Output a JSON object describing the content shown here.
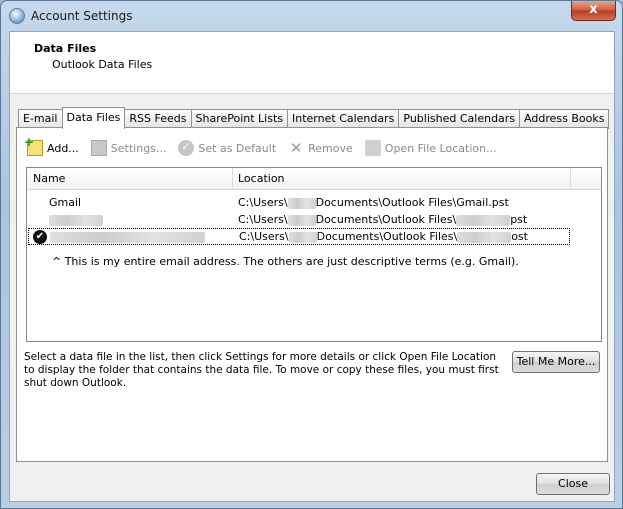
{
  "window": {
    "title": "Account Settings",
    "close_glyph": "x"
  },
  "header": {
    "title": "Data Files",
    "subtitle": "Outlook Data Files"
  },
  "tabs": [
    {
      "label": "E-mail"
    },
    {
      "label": "Data Files",
      "active": true
    },
    {
      "label": "RSS Feeds"
    },
    {
      "label": "SharePoint Lists"
    },
    {
      "label": "Internet Calendars"
    },
    {
      "label": "Published Calendars"
    },
    {
      "label": "Address Books"
    }
  ],
  "toolbar": {
    "add": "Add...",
    "settings": "Settings...",
    "set_default": "Set as Default",
    "remove": "Remove",
    "open_location": "Open File Location..."
  },
  "list": {
    "columns": {
      "name": "Name",
      "location": "Location"
    },
    "rows": [
      {
        "name": "Gmail",
        "loc_prefix": "C:\\Users\\",
        "loc_mid": "Documents\\Outlook Files\\",
        "loc_suffix": "Gmail.pst"
      },
      {
        "name": "",
        "loc_prefix": "C:\\Users\\",
        "loc_mid": "Documents\\Outlook Files\\",
        "loc_suffix": "pst"
      },
      {
        "name": "",
        "loc_prefix": "C:\\Users\\",
        "loc_mid": "Documents\\Outlook Files\\",
        "loc_suffix": "ost",
        "default": true
      }
    ],
    "note": "^ This is my entire email address. The others are just descriptive terms (e.g. Gmail)."
  },
  "help_text": "Select a data file in the list, then click Settings for more details or click Open File Location to display the folder that contains the data file. To move or copy these files, you must first shut down Outlook.",
  "buttons": {
    "tell_me_more": "Tell Me More...",
    "close": "Close"
  }
}
